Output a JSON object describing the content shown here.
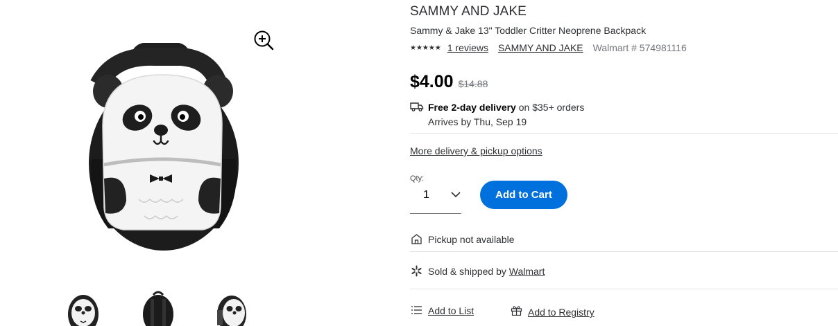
{
  "product": {
    "brand_title": "SAMMY AND JAKE",
    "name": "Sammy & Jake 13\" Toddler Critter Neoprene Backpack",
    "stars": "★★★★★",
    "reviews_link": "1 reviews",
    "brand_link": "SAMMY AND JAKE",
    "item_number": "Walmart # 574981116"
  },
  "pricing": {
    "price": "$4.00",
    "was_price": "$14.88"
  },
  "delivery": {
    "title": "Free 2-day delivery",
    "condition": " on $35+ orders",
    "arrival": "Arrives by Thu, Sep 19",
    "more_options": "More delivery & pickup options"
  },
  "purchase": {
    "qty_label": "Qty:",
    "qty_value": "1",
    "add_to_cart": "Add to Cart"
  },
  "fulfillment": {
    "pickup": "Pickup not available",
    "sold_prefix": "Sold & shipped by ",
    "seller": "Walmart"
  },
  "actions": {
    "add_to_list": "Add to List",
    "add_to_registry": "Add to Registry"
  },
  "gallery": {
    "thumbnails": [
      "panda-backpack-front",
      "backpack-back",
      "panda-backpack-side"
    ]
  },
  "colors": {
    "accent_blue": "#0071dc",
    "text": "#2e2f32",
    "muted": "#74767c"
  }
}
